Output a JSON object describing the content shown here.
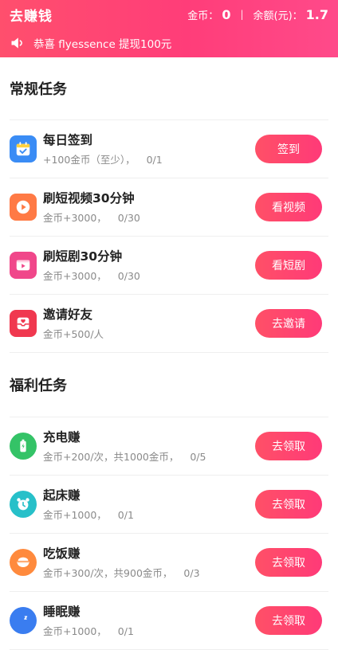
{
  "header": {
    "title": "去赚钱",
    "coins_label": "金币：",
    "coins_value": "0",
    "separator": "|",
    "balance_label": "余额(元)：",
    "balance_value": "1.7"
  },
  "notice": {
    "text": "恭喜 flyessence 提现100元",
    "icon": "speaker-icon"
  },
  "regular": {
    "title": "常规任务",
    "tasks": [
      {
        "name": "每日签到",
        "desc": "+100金币（至少），",
        "progress": "0/1",
        "button": "签到",
        "icon": "calendar-check-icon",
        "color": "#3a8cf5"
      },
      {
        "name": "刷短视频30分钟",
        "desc": "金币+3000，",
        "progress": "0/30",
        "button": "看视频",
        "icon": "play-icon",
        "color": "#ff7a45"
      },
      {
        "name": "刷短剧30分钟",
        "desc": "金币+3000，",
        "progress": "0/30",
        "button": "看短剧",
        "icon": "tv-play-icon",
        "color": "#f0478a"
      },
      {
        "name": "邀请好友",
        "desc": "金币+500/人",
        "progress": "",
        "button": "去邀请",
        "icon": "invite-icon",
        "color": "#f0384f"
      }
    ]
  },
  "welfare": {
    "title": "福利任务",
    "tasks": [
      {
        "name": "充电赚",
        "desc": "金币+200/次，共1000金币，",
        "progress": "0/5",
        "button": "去领取",
        "icon": "battery-icon",
        "color": "#34c367"
      },
      {
        "name": "起床赚",
        "desc": "金币+1000，",
        "progress": "0/1",
        "button": "去领取",
        "icon": "alarm-clock-icon",
        "color": "#27c0c9"
      },
      {
        "name": "吃饭赚",
        "desc": "金币+300/次，共900金币，",
        "progress": "0/3",
        "button": "去领取",
        "icon": "rice-bowl-icon",
        "color": "#ff8a3d"
      },
      {
        "name": "睡眠赚",
        "desc": "金币+1000，",
        "progress": "0/1",
        "button": "去领取",
        "icon": "moon-icon",
        "color": "#3a7df0"
      }
    ]
  }
}
